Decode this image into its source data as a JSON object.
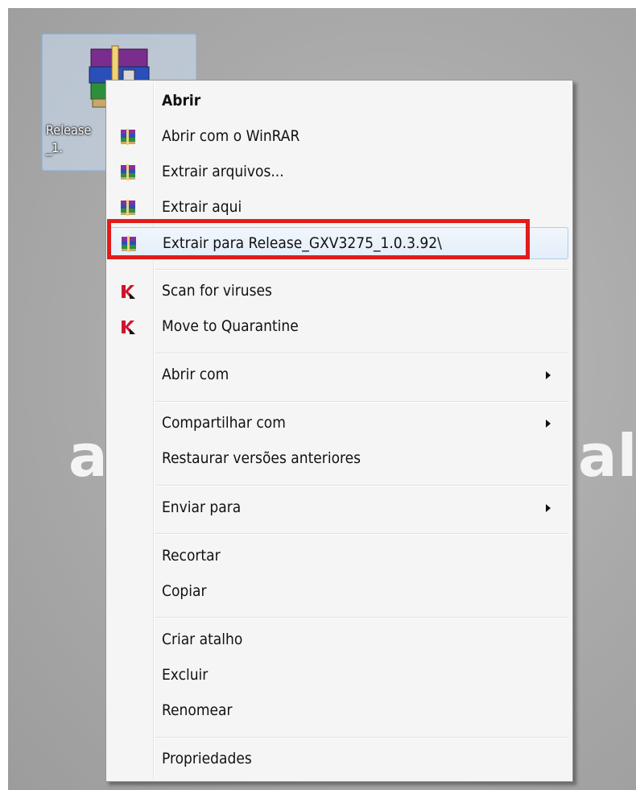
{
  "background": {
    "left_text": "a",
    "right_text": "al."
  },
  "file": {
    "name_line1": "Release",
    "name_line2": "_1.",
    "icon": "winrar-archive-icon"
  },
  "menu": {
    "items": [
      {
        "label": "Abrir",
        "bold": true,
        "icon": null
      },
      {
        "label": "Abrir com o WinRAR",
        "icon": "winrar-icon"
      },
      {
        "label": "Extrair arquivos...",
        "icon": "winrar-icon"
      },
      {
        "label": "Extrair aqui",
        "icon": "winrar-icon"
      },
      {
        "label": "Extrair para Release_GXV3275_1.0.3.92\\",
        "icon": "winrar-icon",
        "hovered": true
      },
      {
        "label": "Scan for viruses",
        "icon": "kaspersky-icon"
      },
      {
        "label": "Move to Quarantine",
        "icon": "kaspersky-icon"
      },
      {
        "label": "Abrir com",
        "submenu": true
      },
      {
        "label": "Compartilhar com",
        "submenu": true
      },
      {
        "label": "Restaurar versões anteriores"
      },
      {
        "label": "Enviar para",
        "submenu": true
      },
      {
        "label": "Recortar"
      },
      {
        "label": "Copiar"
      },
      {
        "label": "Criar atalho"
      },
      {
        "label": "Excluir"
      },
      {
        "label": "Renomear"
      },
      {
        "label": "Propriedades"
      }
    ]
  },
  "colors": {
    "highlight_box": "#e21b1b",
    "hover_fill": "#e3edf9"
  }
}
